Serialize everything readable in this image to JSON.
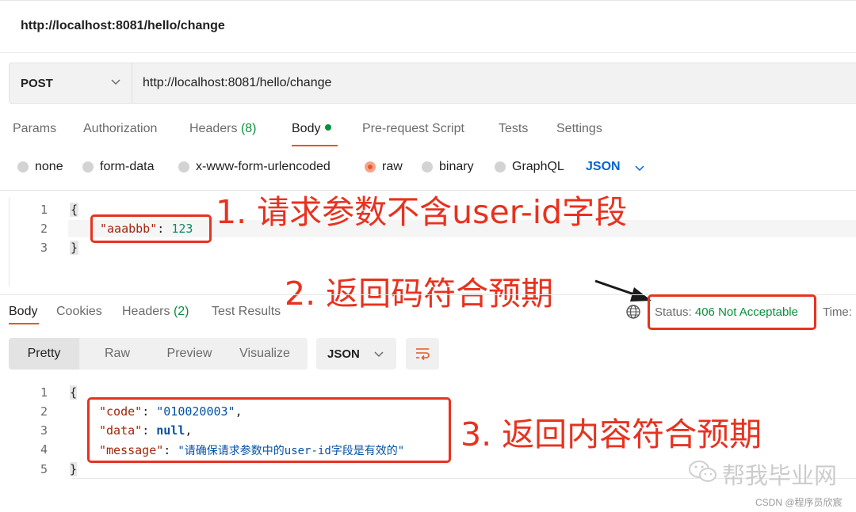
{
  "page": {
    "title": "http://localhost:8081/hello/change"
  },
  "request": {
    "method": "POST",
    "url": "http://localhost:8081/hello/change"
  },
  "request_tabs": [
    {
      "label": "Params"
    },
    {
      "label": "Authorization"
    },
    {
      "label": "Headers",
      "count": "(8)"
    },
    {
      "label": "Body"
    },
    {
      "label": "Pre-request Script"
    },
    {
      "label": "Tests"
    },
    {
      "label": "Settings"
    }
  ],
  "body_types": [
    {
      "label": "none"
    },
    {
      "label": "form-data"
    },
    {
      "label": "x-www-form-urlencoded"
    },
    {
      "label": "raw",
      "selected": true
    },
    {
      "label": "binary"
    },
    {
      "label": "GraphQL"
    }
  ],
  "body_format": "JSON",
  "request_body": {
    "line_numbers": [
      "1",
      "2",
      "3"
    ],
    "open_brace": "{",
    "key": "\"aaabbb\"",
    "colon": ": ",
    "value": "123",
    "close_brace": "}"
  },
  "annotations": {
    "note1": "1. 请求参数不含user-id字段",
    "note2": "2. 返回码符合预期",
    "note3": "3. 返回内容符合预期"
  },
  "response_tabs": [
    {
      "label": "Body"
    },
    {
      "label": "Cookies"
    },
    {
      "label": "Headers",
      "count": "(2)"
    },
    {
      "label": "Test Results"
    }
  ],
  "response_status": {
    "label": "Status:",
    "value": "406 Not Acceptable",
    "time_label": "Time:"
  },
  "view_modes": [
    {
      "label": "Pretty",
      "selected": true
    },
    {
      "label": "Raw"
    },
    {
      "label": "Preview"
    },
    {
      "label": "Visualize"
    }
  ],
  "response_format": "JSON",
  "response_body": {
    "line_numbers": [
      "1",
      "2",
      "3",
      "4",
      "5"
    ],
    "open_brace": "{",
    "close_brace": "}",
    "fields": [
      {
        "key": "\"code\"",
        "value": "\"010020003\"",
        "suffix": ","
      },
      {
        "key": "\"data\"",
        "value": "null",
        "suffix": ","
      },
      {
        "key": "\"message\"",
        "value": "\"请确保请求参数中的user-id字段是有效的\"",
        "suffix": ""
      }
    ]
  },
  "watermark": {
    "wechat": "帮我毕业网",
    "csdn": "CSDN @程序员欣宸"
  },
  "colors": {
    "accent": "#e5581f",
    "success": "#0a8f3c",
    "annotation_red": "#e8321f",
    "link_blue": "#0265d2"
  }
}
